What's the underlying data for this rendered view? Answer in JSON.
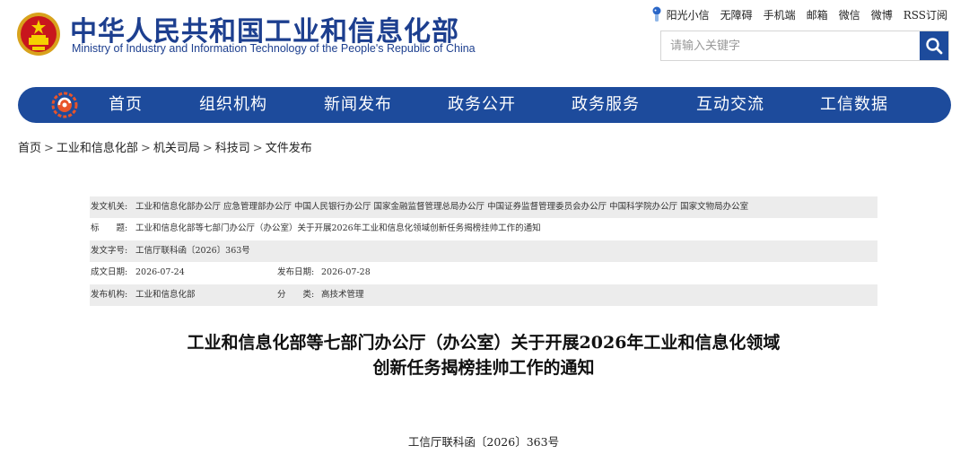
{
  "header": {
    "site_title": "中华人民共和国工业和信息化部",
    "site_subtitle": "Ministry of Industry and Information Technology of the People's Republic of China",
    "emblem_icon": "national-emblem-icon",
    "top_links": [
      "阳光小信",
      "无障碍",
      "手机端",
      "邮箱",
      "微信",
      "微博",
      "RSS订阅"
    ],
    "search_placeholder": "请输入关键字",
    "brand_color": "#1d4b9c"
  },
  "nav": {
    "items": [
      "首页",
      "组织机构",
      "新闻发布",
      "政务公开",
      "政务服务",
      "互动交流",
      "工信数据"
    ]
  },
  "breadcrumb": [
    "首页",
    "工业和信息化部",
    "机关司局",
    "科技司",
    "文件发布"
  ],
  "info": {
    "issuer_label": "发文机关:",
    "issuer_value": "工业和信息化部办公厅 应急管理部办公厅 中国人民银行办公厅 国家金融监督管理总局办公厅 中国证券监督管理委员会办公厅 中国科学院办公厅 国家文物局办公室",
    "title_label": "标　　题:",
    "title_value": "工业和信息化部等七部门办公厅（办公室）关于开展2026年工业和信息化领域创新任务揭榜挂帅工作的通知",
    "number_label": "发文字号:",
    "number_value": "工信厅联科函〔2026〕363号",
    "date_label": "成文日期:",
    "date_value": "2026-07-24",
    "publish_label": "发布日期:",
    "publish_value": "2026-07-28",
    "org_label": "发布机构:",
    "org_value": "工业和信息化部",
    "category_label": "分　　类:",
    "category_value": "高技术管理"
  },
  "document": {
    "title_line1": "工业和信息化部等七部门办公厅（办公室）关于开展2026年工业和信息化领域",
    "title_line2": "创新任务揭榜挂帅工作的通知",
    "number": "工信厅联科函〔2026〕363号"
  }
}
